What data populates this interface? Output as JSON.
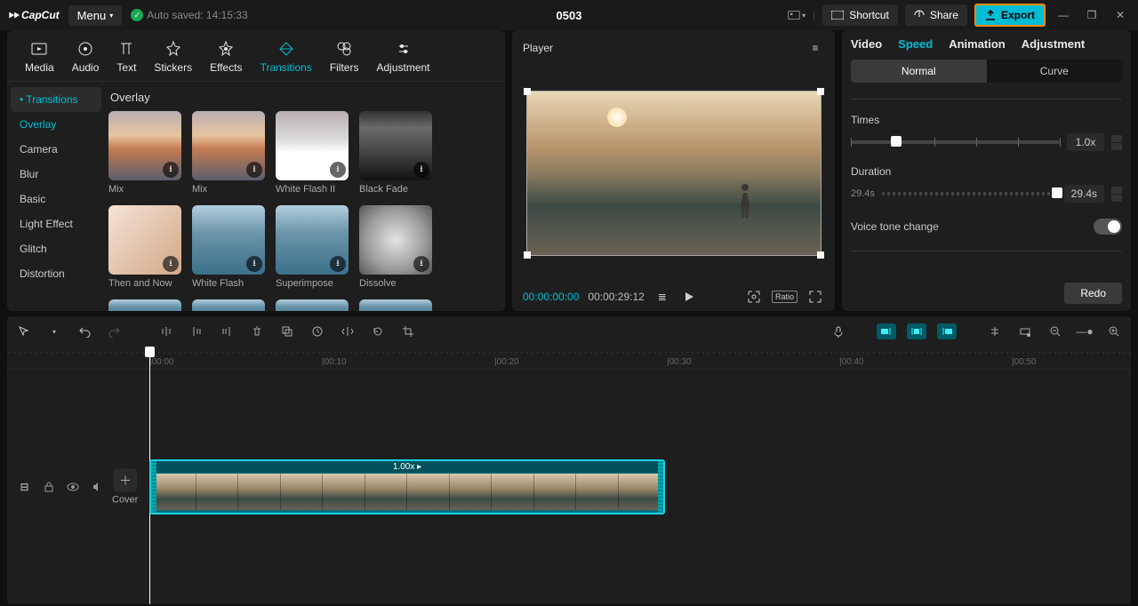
{
  "title_bar": {
    "app_name": "CapCut",
    "menu": "Menu",
    "autosave": "Auto saved: 14:15:33",
    "project": "0503",
    "shortcut": "Shortcut",
    "share": "Share",
    "export": "Export"
  },
  "library": {
    "top_tabs": [
      "Media",
      "Audio",
      "Text",
      "Stickers",
      "Effects",
      "Transitions",
      "Filters",
      "Adjustment"
    ],
    "top_active_index": 5,
    "side": [
      "Transitions",
      "Overlay",
      "Camera",
      "Blur",
      "Basic",
      "Light Effect",
      "Glitch",
      "Distortion"
    ],
    "side_active_index": 1,
    "section_title": "Overlay",
    "items": [
      {
        "label": "Mix",
        "bg": "bg-sunset"
      },
      {
        "label": "Mix",
        "bg": "bg-sunset"
      },
      {
        "label": "White Flash II",
        "bg": "bg-white"
      },
      {
        "label": "Black Fade",
        "bg": "bg-black"
      },
      {
        "label": "Then and Now",
        "bg": "bg-face"
      },
      {
        "label": "White Flash",
        "bg": "bg-city"
      },
      {
        "label": "Superimpose",
        "bg": "bg-city"
      },
      {
        "label": "Dissolve",
        "bg": "bg-dissolve"
      }
    ]
  },
  "player": {
    "title": "Player",
    "current": "00:00:00:00",
    "total": "00:00:29:12",
    "ratio": "Ratio"
  },
  "inspector": {
    "tabs": [
      "Video",
      "Speed",
      "Animation",
      "Adjustment"
    ],
    "active_index": 1,
    "segments": [
      "Normal",
      "Curve"
    ],
    "seg_active": 0,
    "times_label": "Times",
    "times_value": "1.0x",
    "duration_label": "Duration",
    "duration_left": "29.4s",
    "duration_right": "29.4s",
    "voice_label": "Voice tone change",
    "redo": "Redo"
  },
  "timeline": {
    "marks": [
      "|00:00",
      "|00:10",
      "|00:20",
      "|00:30",
      "|00:40",
      "|00:50"
    ],
    "clip_label": "1.00x ▸",
    "cover": "Cover"
  }
}
